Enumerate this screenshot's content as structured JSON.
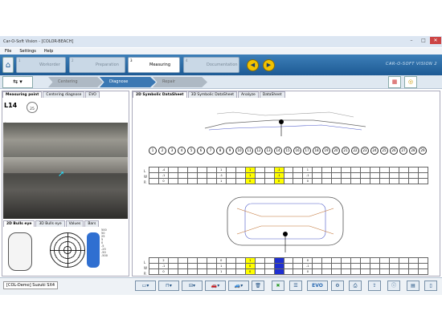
{
  "window": {
    "title": "Car-O-Soft Vision - [COLOR-BEACH]",
    "min": "–",
    "max": "□",
    "close": "✕"
  },
  "menu": [
    "File",
    "Settings",
    "Help"
  ],
  "steps": [
    {
      "num": "1",
      "label": "Workorder"
    },
    {
      "num": "2",
      "label": "Preparation"
    },
    {
      "num": "3",
      "label": "Measuring"
    },
    {
      "num": "4",
      "label": "Documentation"
    }
  ],
  "brand": "CAR-O-SOFT VISION 2",
  "substeps": [
    "Centering",
    "Diagnose",
    "Repair"
  ],
  "left": {
    "tabs": [
      "Measuring point",
      "Centering diagnose",
      "EVO"
    ],
    "point_id": "L14",
    "point_value": "25",
    "lower_tabs": [
      "2D Bulls eye",
      "3D Bulls eye",
      "Values",
      "Bars"
    ],
    "scale": [
      "500",
      "50",
      "25",
      "5",
      "0",
      "-5",
      "-25",
      "-50",
      "-500"
    ]
  },
  "right": {
    "tabs": [
      "2D Symbolic DataSheet",
      "3D Symbolic DataSheet",
      "Analyze",
      "DataSheet"
    ],
    "points": [
      "1",
      "2",
      "3",
      "4",
      "5",
      "6",
      "7",
      "8",
      "9",
      "10",
      "11",
      "12",
      "13",
      "14",
      "15",
      "16",
      "17",
      "18",
      "19",
      "20",
      "21",
      "22",
      "23",
      "24",
      "25",
      "26",
      "27",
      "28",
      "29"
    ],
    "upper_rows": [
      [
        "",
        "-4",
        "",
        "",
        "",
        "",
        "",
        "1",
        "",
        "",
        "1",
        "",
        "",
        "-1",
        "",
        "",
        "1",
        "",
        "",
        "",
        "",
        "",
        "",
        "",
        "",
        "",
        "",
        "",
        ""
      ],
      [
        "",
        "-1",
        "",
        "",
        "",
        "",
        "",
        "-1",
        "",
        "",
        "1",
        "",
        "",
        "-1",
        "",
        "",
        "-1",
        "",
        "",
        "",
        "",
        "",
        "",
        "",
        "",
        "",
        "",
        "",
        ""
      ],
      [
        "",
        "0",
        "",
        "",
        "",
        "",
        "",
        "1",
        "",
        "",
        "0",
        "",
        "",
        "0",
        "",
        "",
        "0",
        "",
        "",
        "",
        "",
        "",
        "",
        "",
        "",
        "",
        "",
        "",
        ""
      ]
    ],
    "lower_rows": [
      [
        "",
        "2",
        "",
        "",
        "",
        "",
        "",
        "0",
        "",
        "",
        "1",
        "",
        "",
        "",
        "",
        "",
        "0",
        "",
        "",
        "",
        "",
        "",
        "",
        "",
        "",
        "",
        "",
        "",
        ""
      ],
      [
        "",
        "-1",
        "",
        "",
        "",
        "",
        "",
        "1",
        "",
        "",
        "0",
        "",
        "",
        "",
        "",
        "",
        "-1",
        "",
        "",
        "",
        "",
        "",
        "",
        "",
        "",
        "",
        "",
        "",
        ""
      ],
      [
        "",
        "0",
        "",
        "",
        "",
        "",
        "",
        "1",
        "",
        "",
        "0",
        "",
        "",
        "",
        "",
        "",
        "0",
        "",
        "",
        "",
        "",
        "",
        "",
        "",
        "",
        "",
        "",
        "",
        ""
      ]
    ],
    "row_labels": [
      "L",
      "W",
      "R"
    ]
  },
  "status": {
    "vehicle": "[COL-Demo] Suzuki SX4",
    "evo": "EVO"
  },
  "colors": {
    "topbar": "#1d5a94",
    "active_substep": "#3b78b3",
    "highlight": "#ffff00",
    "blue_cell": "#1f2fd1",
    "nav": "#f2c200"
  }
}
